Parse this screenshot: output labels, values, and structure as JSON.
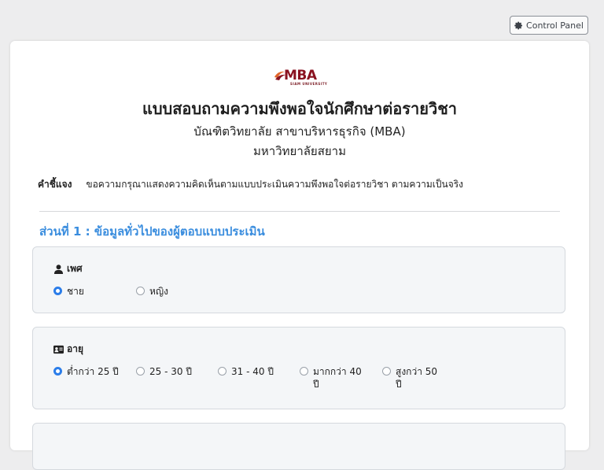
{
  "top_bar": {
    "control_panel_label": "Control Panel"
  },
  "logo": {
    "brand": "MBA",
    "university": "SIAM UNIVERSITY"
  },
  "header": {
    "title": "แบบสอบถามความพึงพอใจนักศึกษาต่อรายวิชา",
    "subtitle": "บัณฑิตวิทยาลัย สาขาบริหารธุรกิจ (MBA)",
    "university": "มหาวิทยาลัยสยาม"
  },
  "instruction": {
    "label": "คำชี้แจง",
    "text": "ขอความกรุณาแสดงความคิดเห็นตามแบบประเมินความพึงพอใจต่อรายวิชา ตามความเป็นจริง"
  },
  "section1": {
    "title": "ส่วนที่ 1 : ข้อมูลทั่วไปของผู้ตอบแบบประเมิน",
    "gender": {
      "label": "เพศ",
      "options": [
        {
          "label": "ชาย",
          "selected": true
        },
        {
          "label": "หญิง",
          "selected": false
        }
      ]
    },
    "age": {
      "label": "อายุ",
      "options": [
        {
          "label": "ต่ำกว่า 25 ปี",
          "selected": true
        },
        {
          "label": "25 - 30 ปี",
          "selected": false
        },
        {
          "label": "31 - 40 ปี",
          "selected": false
        },
        {
          "label": "มากกว่า 40 ปี",
          "selected": false
        },
        {
          "label": "สูงกว่า 50 ปี",
          "selected": false
        }
      ]
    }
  },
  "colors": {
    "accent": "#2b7de9",
    "section_title": "#3a8dde",
    "brand": "#8a1220"
  }
}
